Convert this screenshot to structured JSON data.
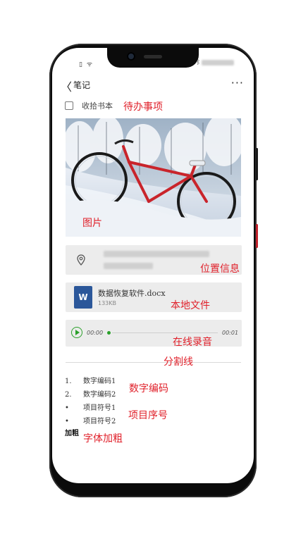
{
  "status_bar": {
    "left_icons": [
      "sim-icon",
      "wifi-icon"
    ],
    "right_icons": [
      "bluetooth-icon",
      "battery-icon"
    ]
  },
  "header": {
    "back_glyph": "〈",
    "title": "笔记",
    "more_glyph": "···"
  },
  "todo": {
    "text": "收拾书本",
    "checked": false
  },
  "location": {
    "icon": "location-pin-icon"
  },
  "file": {
    "icon_letter": "W",
    "name": "数据恢复软件.docx",
    "size": "133KB"
  },
  "audio": {
    "start_time": "00:00",
    "end_time": "00:01",
    "progress": 0
  },
  "numbered_list": [
    {
      "marker": "1.",
      "text": "数字编码1"
    },
    {
      "marker": "2.",
      "text": "数字编码2"
    }
  ],
  "bullet_list": [
    {
      "marker": "•",
      "text": "项目符号1"
    },
    {
      "marker": "•",
      "text": "项目符号2"
    }
  ],
  "bold_text": "加粗",
  "annotations": {
    "todo": "待办事项",
    "image": "图片",
    "location": "位置信息",
    "file": "本地文件",
    "audio": "在线录音",
    "divider": "分割线",
    "numbered": "数字编码",
    "bullets": "项目序号",
    "bold": "字体加粗"
  },
  "colors": {
    "annotation": "#e0202a",
    "accent_green": "#2aa02a",
    "word_blue": "#2b579a",
    "card_bg": "#ececec"
  }
}
